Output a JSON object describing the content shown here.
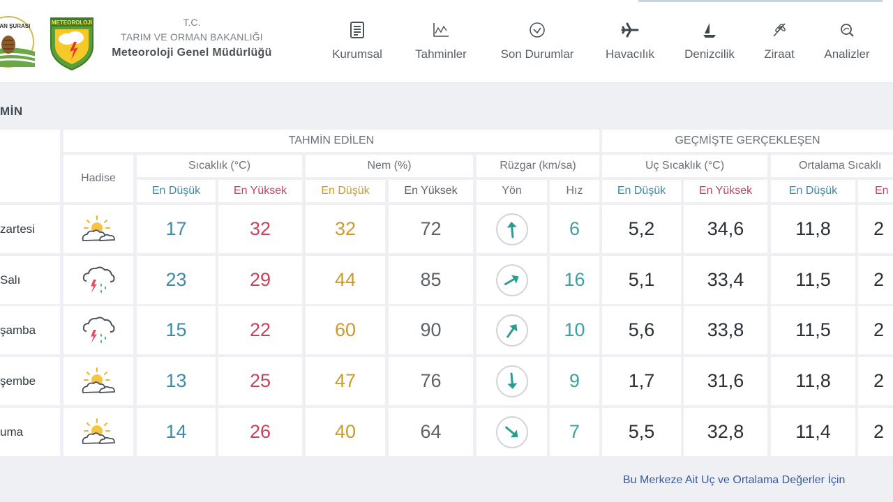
{
  "header": {
    "tc": "T.C.",
    "ministry": "TARIM VE ORMAN BAKANLIĞI",
    "agency": "Meteoroloji Genel Müdürlüğü",
    "logo1_text": "ORMAN ŞURASI",
    "logo2_text": "METEOROLOJİ"
  },
  "nav": [
    {
      "label": "Kurumsal",
      "icon": "document-icon"
    },
    {
      "label": "Tahminler",
      "icon": "chart-icon"
    },
    {
      "label": "Son Durumlar",
      "icon": "check-circle-icon"
    },
    {
      "label": "Havacılık",
      "icon": "airplane-icon"
    },
    {
      "label": "Denizcilik",
      "icon": "sailboat-icon"
    },
    {
      "label": "Ziraat",
      "icon": "wheat-icon"
    },
    {
      "label": "Analizler",
      "icon": "analysis-icon"
    }
  ],
  "section_title": "MİN",
  "table": {
    "group_forecast": "TAHMİN EDİLEN",
    "group_past": "GEÇMİŞTE GERÇEKLEŞEN",
    "hadise": "Hadise",
    "temp": "Sıcaklık (°C)",
    "humidity": "Nem (%)",
    "wind": "Rüzgar (km/sa)",
    "extreme_temp": "Uç Sıcaklık (°C)",
    "avg_temp": "Ortalama Sıcaklı",
    "min": "En Düşük",
    "max": "En Yüksek",
    "max_cut": "En",
    "direction": "Yön",
    "speed": "Hız",
    "rows": [
      {
        "day": "zartesi",
        "icon": "partly-cloudy-icon",
        "tmin": "17",
        "tmax": "32",
        "hmin": "32",
        "hmax": "72",
        "wind_deg": 355,
        "speed": "6",
        "umin": "5,2",
        "umax": "34,6",
        "amin": "11,8",
        "amax": "2"
      },
      {
        "day": "Salı",
        "icon": "thunderstorm-icon",
        "tmin": "23",
        "tmax": "29",
        "hmin": "44",
        "hmax": "85",
        "wind_deg": 60,
        "speed": "16",
        "umin": "5,1",
        "umax": "33,4",
        "amin": "11,5",
        "amax": "2"
      },
      {
        "day": "şamba",
        "icon": "thunderstorm-icon",
        "tmin": "15",
        "tmax": "22",
        "hmin": "60",
        "hmax": "90",
        "wind_deg": 35,
        "speed": "10",
        "umin": "5,6",
        "umax": "33,8",
        "amin": "11,5",
        "amax": "2"
      },
      {
        "day": "şembe",
        "icon": "partly-cloudy-icon",
        "tmin": "13",
        "tmax": "25",
        "hmin": "47",
        "hmax": "76",
        "wind_deg": 175,
        "speed": "9",
        "umin": "1,7",
        "umax": "31,6",
        "amin": "11,8",
        "amax": "2"
      },
      {
        "day": "uma",
        "icon": "partly-cloudy-icon",
        "tmin": "14",
        "tmax": "26",
        "hmin": "40",
        "hmax": "64",
        "wind_deg": 130,
        "speed": "7",
        "umin": "5,5",
        "umax": "32,8",
        "amin": "11,4",
        "amax": "2"
      }
    ]
  },
  "footer_link": "Bu Merkeze Ait Uç ve Ortalama Değerler İçin"
}
